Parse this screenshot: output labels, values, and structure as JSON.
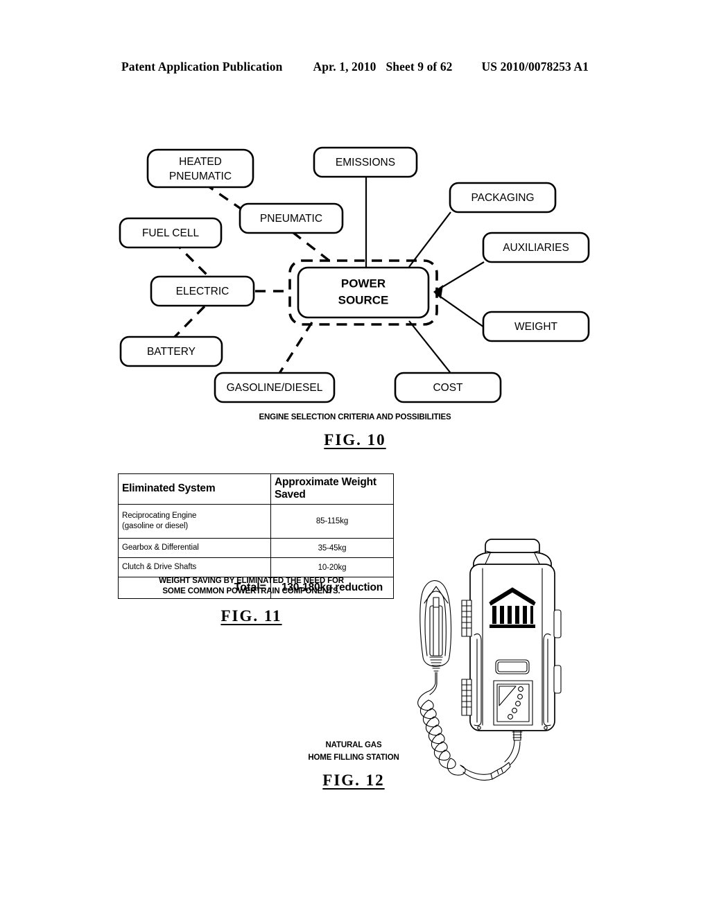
{
  "header": {
    "publication": "Patent Application Publication",
    "date": "Apr. 1, 2010",
    "sheet": "Sheet 9 of 62",
    "document_number": "US 2010/0078253 A1"
  },
  "fig10": {
    "label": "FIG.  10",
    "subtitle": "ENGINE SELECTION CRITERIA AND POSSIBILITIES",
    "center_node": {
      "line1": "POWER",
      "line2": "SOURCE"
    },
    "nodes": [
      {
        "id": "heated-pneumatic",
        "line1": "HEATED",
        "line2": "PNEUMATIC",
        "edge": "dashed"
      },
      {
        "id": "pneumatic",
        "line1": "PNEUMATIC",
        "line2": "",
        "edge": "dashed"
      },
      {
        "id": "fuel-cell",
        "line1": "FUEL  CELL",
        "line2": "",
        "edge": "dashed"
      },
      {
        "id": "electric",
        "line1": "ELECTRIC",
        "line2": "",
        "edge": "dashed"
      },
      {
        "id": "battery",
        "line1": "BATTERY",
        "line2": "",
        "edge": "dashed"
      },
      {
        "id": "gasoline-diesel",
        "line1": "GASOLINE/DIESEL",
        "line2": "",
        "edge": "dashed"
      },
      {
        "id": "emissions",
        "line1": "EMISSIONS",
        "line2": "",
        "edge": "solid"
      },
      {
        "id": "packaging",
        "line1": "PACKAGING",
        "line2": "",
        "edge": "solid"
      },
      {
        "id": "auxiliaries",
        "line1": "AUXILIARIES",
        "line2": "",
        "edge": "solid"
      },
      {
        "id": "weight",
        "line1": "WEIGHT",
        "line2": "",
        "edge": "solid"
      },
      {
        "id": "cost",
        "line1": "COST",
        "line2": "",
        "edge": "solid"
      }
    ]
  },
  "fig11": {
    "label": "FIG.  11",
    "subtitle_line1": "WEIGHT SAVING BY ELIMINATED THE NEED FOR",
    "subtitle_line2": "SOME COMMON POWERTRAIN COMPONENTS.",
    "columns": [
      "Eliminated System",
      "Approximate Weight Saved"
    ],
    "rows": [
      {
        "system_line1": "Reciprocating Engine",
        "system_line2": "(gasoline or diesel)",
        "weight": "85-115kg"
      },
      {
        "system_line1": "Gearbox & Differential",
        "system_line2": "",
        "weight": "35-45kg"
      },
      {
        "system_line1": "Clutch & Drive Shafts",
        "system_line2": "",
        "weight": "10-20kg"
      }
    ],
    "total_label": "Total=",
    "total_value": "130-180kg reduction"
  },
  "fig12": {
    "label": "FIG.  12",
    "caption_line1": "NATURAL GAS",
    "caption_line2": "HOME FILLING STATION"
  }
}
